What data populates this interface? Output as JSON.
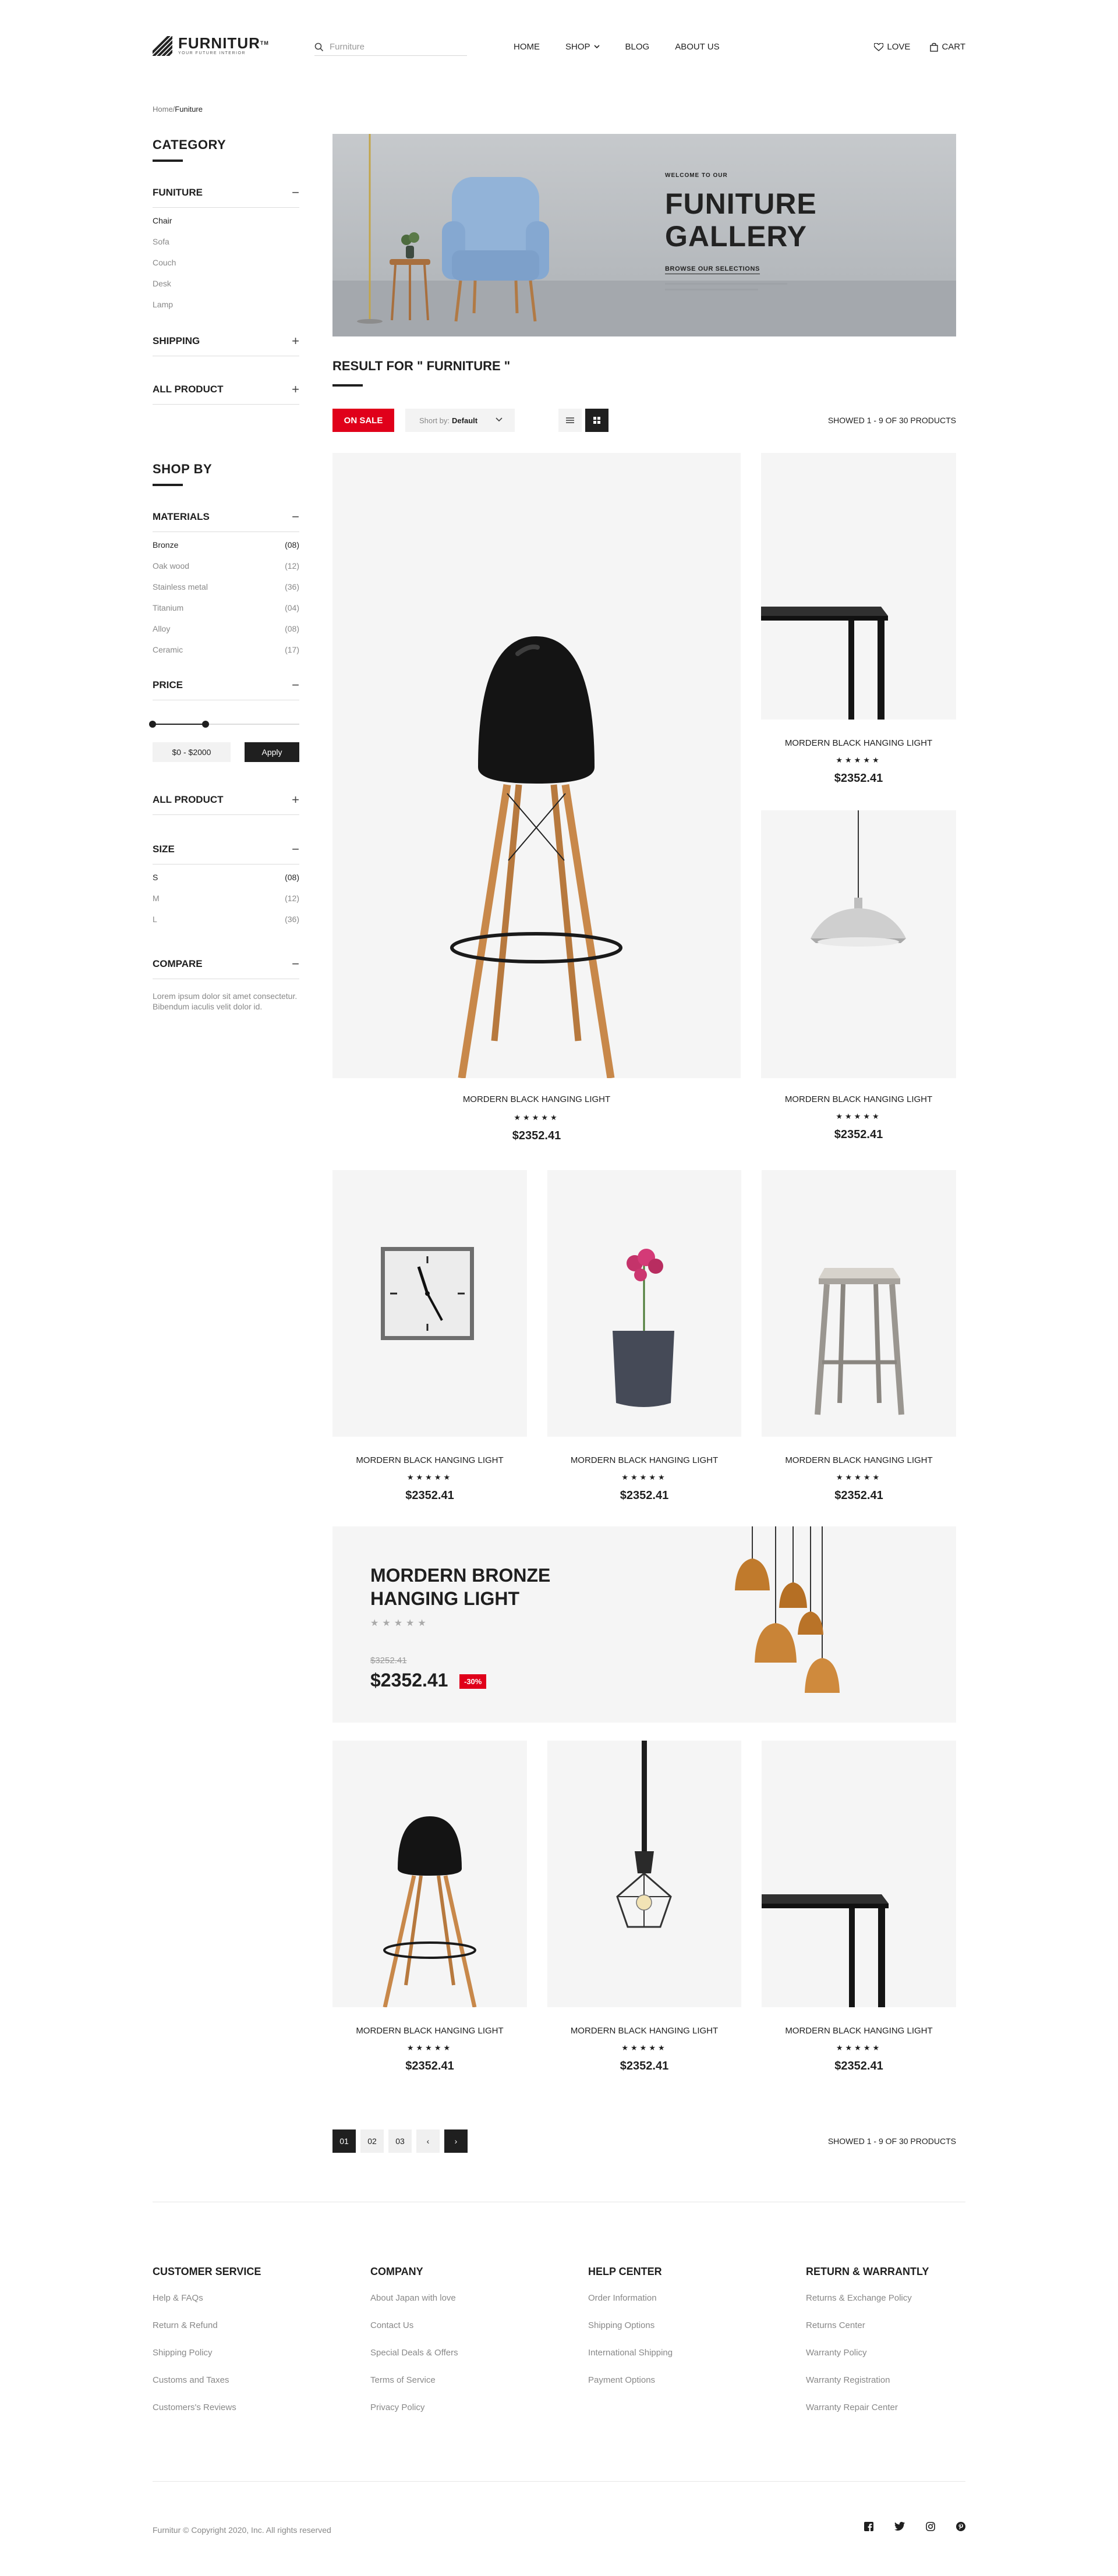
{
  "header": {
    "logo_name": "FURNITUR",
    "logo_tm": "TM",
    "logo_tagline": "YOUR FUTURE INTERIOR",
    "search_placeholder": "Furniture",
    "nav": [
      "HOME",
      "SHOP",
      "BLOG",
      "ABOUT US"
    ],
    "love_label": "LOVE",
    "cart_label": "CART"
  },
  "breadcrumb": {
    "home": "Home/",
    "current": "Funiture"
  },
  "sidebar": {
    "category_title": "CATEGORY",
    "funiture_label": "FUNITURE",
    "funiture_items": [
      "Chair",
      "Sofa",
      "Couch",
      "Desk",
      "Lamp"
    ],
    "shipping_label": "SHIPPING",
    "all_product_label": "ALL PRODUCT",
    "shopby_title": "SHOP BY",
    "materials_label": "MATERIALS",
    "materials": [
      {
        "name": "Bronze",
        "count": "(08)"
      },
      {
        "name": "Oak wood",
        "count": "(12)"
      },
      {
        "name": "Stainless metal",
        "count": "(36)"
      },
      {
        "name": "Titanium",
        "count": "(04)"
      },
      {
        "name": "Alloy",
        "count": "(08)"
      },
      {
        "name": "Ceramic",
        "count": "(17)"
      }
    ],
    "price_label": "PRICE",
    "price_range": "$0 - $2000",
    "price_slider_fraction": 0.36,
    "apply_label": "Apply",
    "all_product_label_2": "ALL PRODUCT",
    "size_label": "SIZE",
    "sizes": [
      {
        "name": "S",
        "count": "(08)"
      },
      {
        "name": "M",
        "count": "(12)"
      },
      {
        "name": "L",
        "count": "(36)"
      }
    ],
    "compare_label": "COMPARE",
    "compare_text": "Lorem ipsum dolor sit amet consectetur. Bibendum iaculis velit dolor id."
  },
  "hero": {
    "welcome": "WELCOME TO OUR",
    "title_line1": "FUNITURE",
    "title_line2": "GALLERY",
    "browse": "BROWSE OUR SELECTIONS"
  },
  "results": {
    "title": "RESULT FOR \" FURNITURE \"",
    "sale_label": "ON SALE",
    "sort_prefix": "Short by:",
    "sort_value": "Default",
    "showed_text": "SHOWED 1 - 9 OF 30 PRODUCTS"
  },
  "products": [
    {
      "name": "MORDERN BLACK HANGING LIGHT",
      "stars": "★★★★★",
      "price": "$2352.41"
    },
    {
      "name": "MORDERN BLACK HANGING LIGHT",
      "stars": "★★★★★",
      "price": "$2352.41"
    },
    {
      "name": "MORDERN BLACK HANGING LIGHT",
      "stars": "★★★★★",
      "price": "$2352.41"
    },
    {
      "name": "MORDERN BLACK HANGING LIGHT",
      "stars": "★★★★★",
      "price": "$2352.41"
    },
    {
      "name": "MORDERN BLACK HANGING LIGHT",
      "stars": "★★★★★",
      "price": "$2352.41"
    },
    {
      "name": "MORDERN BLACK HANGING LIGHT",
      "stars": "★★★★★",
      "price": "$2352.41"
    },
    {
      "name": "MORDERN BLACK HANGING LIGHT",
      "stars": "★★★★★",
      "price": "$2352.41"
    },
    {
      "name": "MORDERN BLACK HANGING LIGHT",
      "stars": "★★★★★",
      "price": "$2352.41"
    },
    {
      "name": "MORDERN BLACK HANGING LIGHT",
      "stars": "★★★★★",
      "price": "$2352.41"
    }
  ],
  "promo": {
    "title": "MORDERN BRONZE HANGING LIGHT",
    "stars": "★★★★★",
    "old_price": "$3252.41",
    "new_price": "$2352.41",
    "discount": "-30%"
  },
  "pagination": {
    "pages": [
      "01",
      "02",
      "03"
    ],
    "prev": "‹",
    "next": "›",
    "showed_text": "SHOWED 1 - 9 OF 30 PRODUCTS"
  },
  "footer": {
    "columns": [
      {
        "title": "CUSTOMER SERVICE",
        "links": [
          "Help & FAQs",
          "Return & Refund",
          "Shipping Policy",
          "Customs and Taxes",
          "Customers's Reviews"
        ]
      },
      {
        "title": "COMPANY",
        "links": [
          "About Japan with love",
          "Contact Us",
          "Special Deals & Offers",
          "Terms of Service",
          "Privacy Policy"
        ]
      },
      {
        "title": "HELP CENTER",
        "links": [
          "Order Information",
          "Shipping Options",
          "International Shipping",
          "Payment Options"
        ]
      },
      {
        "title": "RETURN & WARRANTLY",
        "links": [
          "Returns & Exchange Policy",
          "Returns Center",
          "Warranty Policy",
          "Warranty Registration",
          "Warranty Repair Center"
        ]
      }
    ],
    "copyright": "Furnitur © Copyright 2020, Inc. All rights reserved",
    "social": [
      "facebook-icon",
      "twitter-icon",
      "instagram-icon",
      "pinterest-icon"
    ]
  },
  "colors": {
    "accent": "#e0001a",
    "dark": "#1f1f1f",
    "card_bg": "#f5f5f5"
  }
}
